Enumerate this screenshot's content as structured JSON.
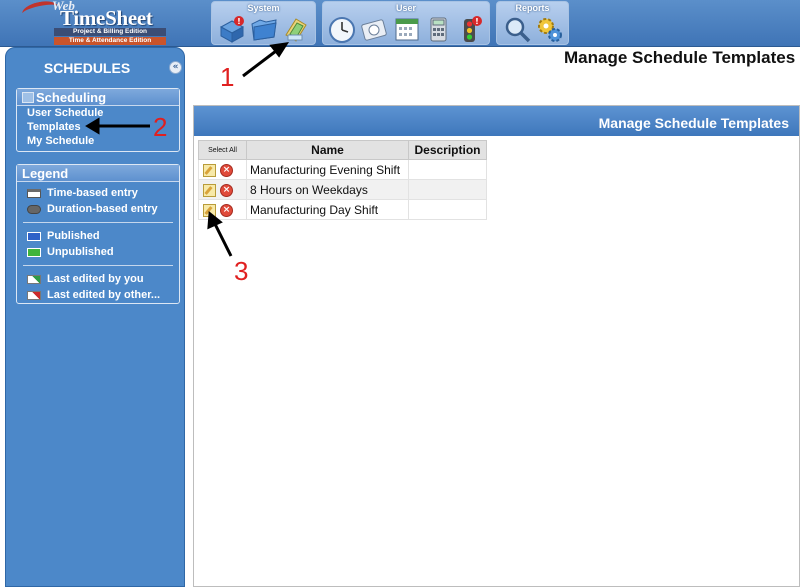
{
  "header": {
    "logo": {
      "web": "Web",
      "name": "TimeSheet",
      "edition_1": "Project & Billing Edition",
      "edition_2": "Time & Attendance Edition"
    },
    "groups": [
      {
        "label": "System",
        "tools": [
          "system-alert-icon",
          "folder-icon",
          "templates-icon"
        ]
      },
      {
        "label": "User",
        "tools": [
          "clock-icon",
          "timesheet-icon",
          "calendar-icon",
          "calculator-icon",
          "traffic-light-icon"
        ]
      },
      {
        "label": "Reports",
        "tools": [
          "magnifier-icon",
          "gears-icon"
        ]
      }
    ]
  },
  "sidebar": {
    "title": "SCHEDULES",
    "collapse_label": "«",
    "scheduling": {
      "title": "Scheduling",
      "links": [
        "User Schedule",
        "Templates",
        "My Schedule"
      ]
    },
    "legend": {
      "title": "Legend",
      "items": [
        {
          "label": "Time-based entry",
          "color": "#7f7f7f"
        },
        {
          "label": "Duration-based entry",
          "color": "#666666"
        },
        {
          "label": "Published",
          "color": "#2f62c8"
        },
        {
          "label": "Unpublished",
          "color": "#3fb43c"
        },
        {
          "label": "Last edited by you",
          "color": "#2f9a46"
        },
        {
          "label": "Last edited by other...",
          "color": "#cc2a2a"
        }
      ]
    }
  },
  "main": {
    "page_title": "Manage Schedule Templates",
    "panel_title": "Manage Schedule Templates",
    "table": {
      "headers": {
        "select_all": "Select All",
        "name": "Name",
        "description": "Description"
      },
      "rows": [
        {
          "name": "Manufacturing Evening Shift",
          "description": ""
        },
        {
          "name": "8 Hours on Weekdays",
          "description": ""
        },
        {
          "name": "Manufacturing Day Shift",
          "description": ""
        }
      ]
    }
  },
  "annotations": [
    "1",
    "2",
    "3"
  ],
  "colors": {
    "accent": "#4c88c9",
    "annotation": "#e02020"
  }
}
